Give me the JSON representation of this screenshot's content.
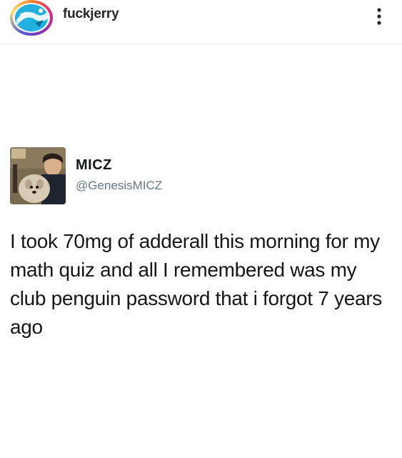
{
  "post_header": {
    "account_name": "fuckjerry",
    "avatar_icon": "brand-logo-icon",
    "more_icon": "more-vertical-icon"
  },
  "tweet": {
    "display_name": "MICZ",
    "handle": "@GenesisMICZ",
    "avatar_icon": "profile-photo",
    "text": "I took 70mg of adderall this morning for my math quiz and all I remembered was my club penguin password that i forgot 7 years ago"
  },
  "colors": {
    "username": "#262626",
    "handle": "#657786",
    "tweet_text": "#14171a"
  }
}
